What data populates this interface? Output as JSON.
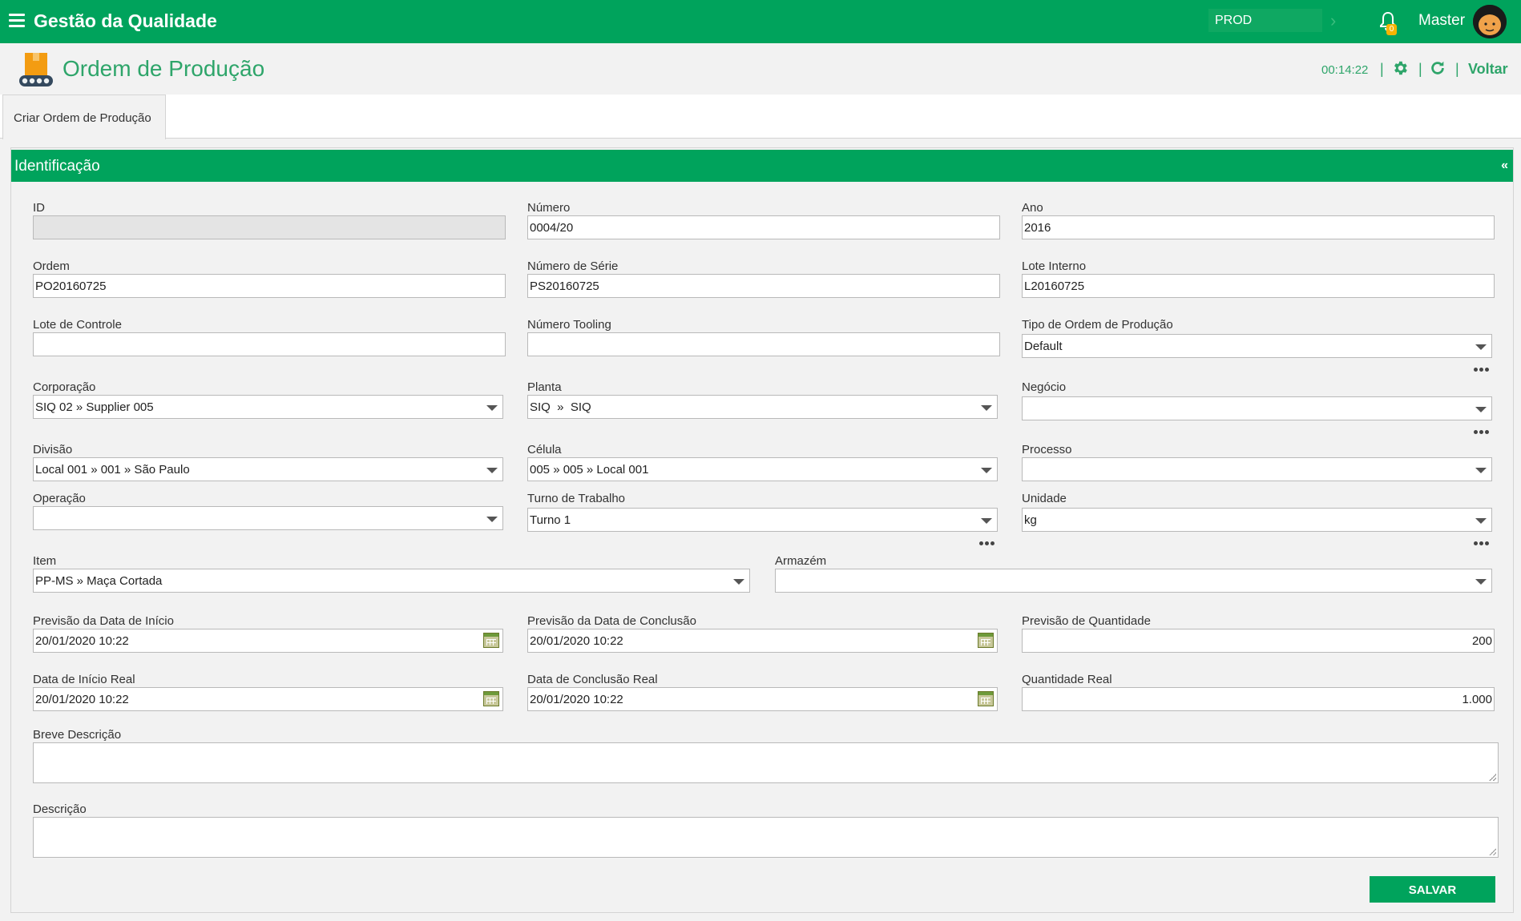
{
  "topbar": {
    "app_title": "Gestão da Qualidade",
    "environment": "PROD",
    "notification_count": "0",
    "user_name": "Master"
  },
  "page": {
    "title": "Ordem de Produção",
    "timer": "00:14:22",
    "back_label": "Voltar"
  },
  "tabs": [
    {
      "label": "Criar Ordem de Produção",
      "active": true
    }
  ],
  "panel": {
    "title": "Identificação",
    "collapse_glyph": "«"
  },
  "fields": {
    "id": {
      "label": "ID",
      "value": ""
    },
    "numero": {
      "label": "Número",
      "value": "0004/20"
    },
    "ano": {
      "label": "Ano",
      "value": "2016"
    },
    "ordem": {
      "label": "Ordem",
      "value": "PO20160725"
    },
    "numero_serie": {
      "label": "Número de Série",
      "value": "PS20160725"
    },
    "lote_interno": {
      "label": "Lote Interno",
      "value": "L20160725"
    },
    "lote_controle": {
      "label": "Lote de Controle",
      "value": ""
    },
    "numero_tooling": {
      "label": "Número Tooling",
      "value": ""
    },
    "tipo_ordem": {
      "label": "Tipo de Ordem de Produção",
      "value": "Default"
    },
    "corporacao": {
      "label": "Corporação",
      "value": "SIQ 02 » Supplier 005"
    },
    "planta": {
      "label": "Planta",
      "value": "SIQ  »  SIQ"
    },
    "negocio": {
      "label": "Negócio",
      "value": ""
    },
    "divisao": {
      "label": "Divisão",
      "value": "Local 001 » 001 » São Paulo"
    },
    "celula": {
      "label": "Célula",
      "value": "005 » 005 » Local 001"
    },
    "processo": {
      "label": "Processo",
      "value": ""
    },
    "operacao": {
      "label": "Operação",
      "value": ""
    },
    "turno": {
      "label": "Turno de Trabalho",
      "value": "Turno 1"
    },
    "unidade": {
      "label": "Unidade",
      "value": "kg"
    },
    "item": {
      "label": "Item",
      "value": "PP-MS » Maça Cortada"
    },
    "armazem": {
      "label": "Armazém",
      "value": ""
    },
    "prev_inicio": {
      "label": "Previsão da Data de Início",
      "value": "20/01/2020 10:22"
    },
    "prev_conclusao": {
      "label": "Previsão da Data de Conclusão",
      "value": "20/01/2020 10:22"
    },
    "prev_quantidade": {
      "label": "Previsão de Quantidade",
      "value": "200"
    },
    "inicio_real": {
      "label": "Data de Início Real",
      "value": "20/01/2020 10:22"
    },
    "conclusao_real": {
      "label": "Data de Conclusão Real",
      "value": "20/01/2020 10:22"
    },
    "quantidade_real": {
      "label": "Quantidade Real",
      "value": "1.000"
    },
    "breve_descricao": {
      "label": "Breve Descrição",
      "value": ""
    },
    "descricao": {
      "label": "Descrição",
      "value": ""
    }
  },
  "actions": {
    "save_label": "SALVAR"
  },
  "colors": {
    "brand_green": "#00a35c",
    "accent_text_green": "#2ea56a"
  }
}
